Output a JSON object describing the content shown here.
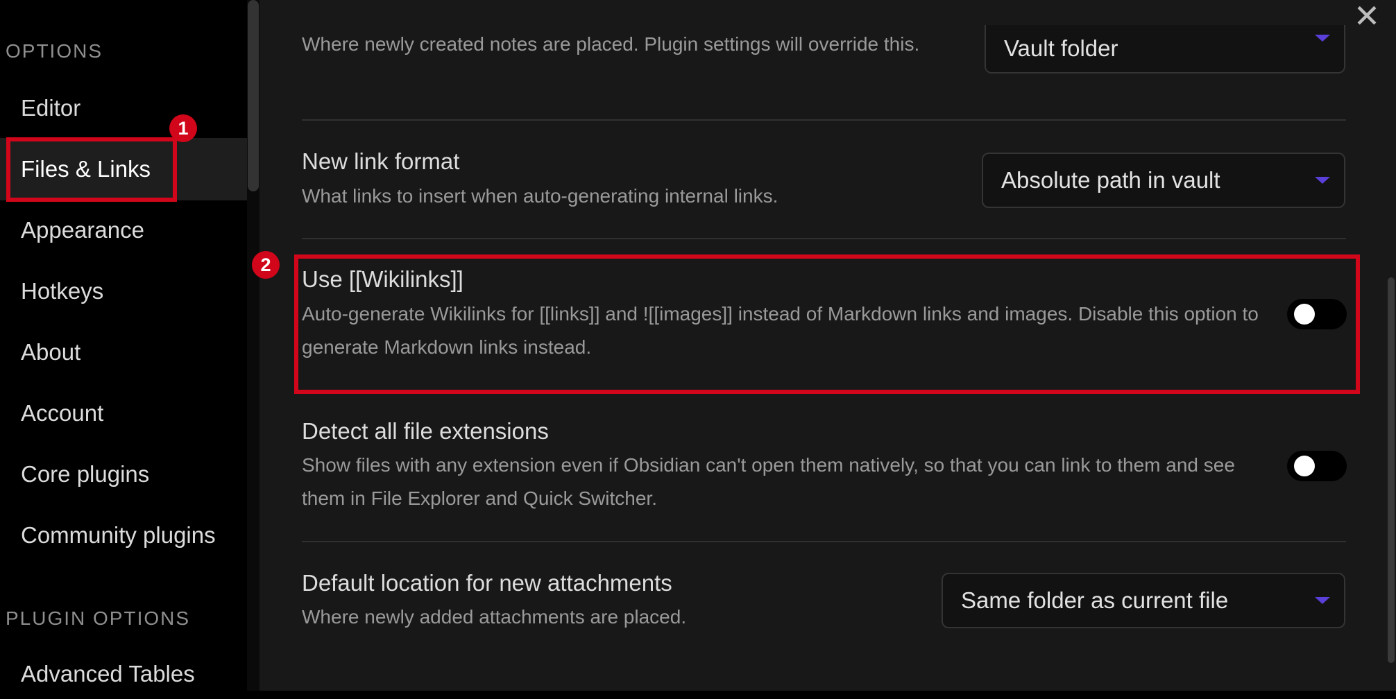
{
  "window": {
    "close_glyph": "✕"
  },
  "sidebar": {
    "options_header": "OPTIONS",
    "plugin_options_header": "PLUGIN OPTIONS",
    "items": [
      {
        "label": "Editor",
        "active": false
      },
      {
        "label": "Files & Links",
        "active": true
      },
      {
        "label": "Appearance",
        "active": false
      },
      {
        "label": "Hotkeys",
        "active": false
      },
      {
        "label": "About",
        "active": false
      },
      {
        "label": "Account",
        "active": false
      },
      {
        "label": "Core plugins",
        "active": false
      },
      {
        "label": "Community plugins",
        "active": false
      }
    ],
    "plugin_items": [
      {
        "label": "Advanced Tables"
      }
    ]
  },
  "settings": {
    "new_note_location": {
      "description": "Where newly created notes are placed. Plugin settings will override this.",
      "value": "Vault folder"
    },
    "new_link_format": {
      "name": "New link format",
      "description": "What links to insert when auto-generating internal links.",
      "value": "Absolute path in vault"
    },
    "use_wikilinks": {
      "name": "Use [[Wikilinks]]",
      "description": "Auto-generate Wikilinks for [[links]] and ![[images]] instead of Markdown links and images. Disable this option to generate Markdown links instead.",
      "enabled": false
    },
    "detect_extensions": {
      "name": "Detect all file extensions",
      "description": "Show files with any extension even if Obsidian can't open them natively, so that you can link to them and see them in File Explorer and Quick Switcher.",
      "enabled": false
    },
    "attachment_location": {
      "name": "Default location for new attachments",
      "description": "Where newly added attachments are placed.",
      "value": "Same folder as current file"
    }
  },
  "annotations": {
    "badge_1": "1",
    "badge_2": "2",
    "highlight_color": "#d1061a"
  },
  "colors": {
    "accent": "#5a3fd8",
    "sidebar_active_bg": "#1e1e1e",
    "main_bg": "#181818"
  }
}
